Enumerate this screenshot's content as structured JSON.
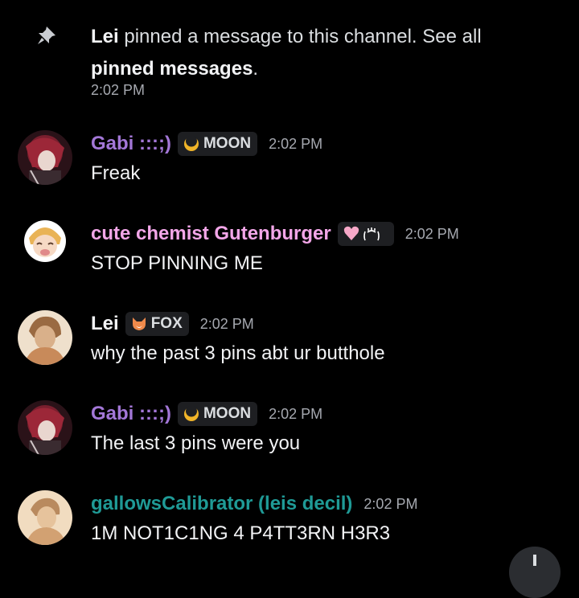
{
  "system": {
    "actor": "Lei",
    "text_before_link": " pinned a message to this channel. See all ",
    "link": "pinned messages",
    "text_after_link": ".",
    "time": "2:02 PM"
  },
  "colors": {
    "gabi": "#a377d7",
    "gutenberger": "#f2a6e8",
    "lei": "#f2f3f5",
    "gallows": "#1f9a96",
    "background": "#000000"
  },
  "messages": [
    {
      "username": "Gabi :::;)",
      "tag": {
        "label": "MOON",
        "icon": "moon-badge-icon"
      },
      "time": "2:02 PM",
      "text": "Freak"
    },
    {
      "username": "cute chemist Gutenburger",
      "tag": {
        "label": "",
        "icon": "heart-kaomoji-badge-icon"
      },
      "time": "2:02 PM",
      "text": "STOP PINNING ME"
    },
    {
      "username": "Lei",
      "tag": {
        "label": "FOX",
        "icon": "fox-badge-icon"
      },
      "time": "2:02 PM",
      "text": "why the past 3 pins abt ur butthole"
    },
    {
      "username": "Gabi :::;)",
      "tag": {
        "label": "MOON",
        "icon": "moon-badge-icon"
      },
      "time": "2:02 PM",
      "text": "The last 3 pins were you"
    },
    {
      "username": "gallowsCalibrator (leis decil)",
      "time": "2:02 PM",
      "text": "1M NOT1C1NG 4 P4TT3RN H3R3"
    }
  ]
}
